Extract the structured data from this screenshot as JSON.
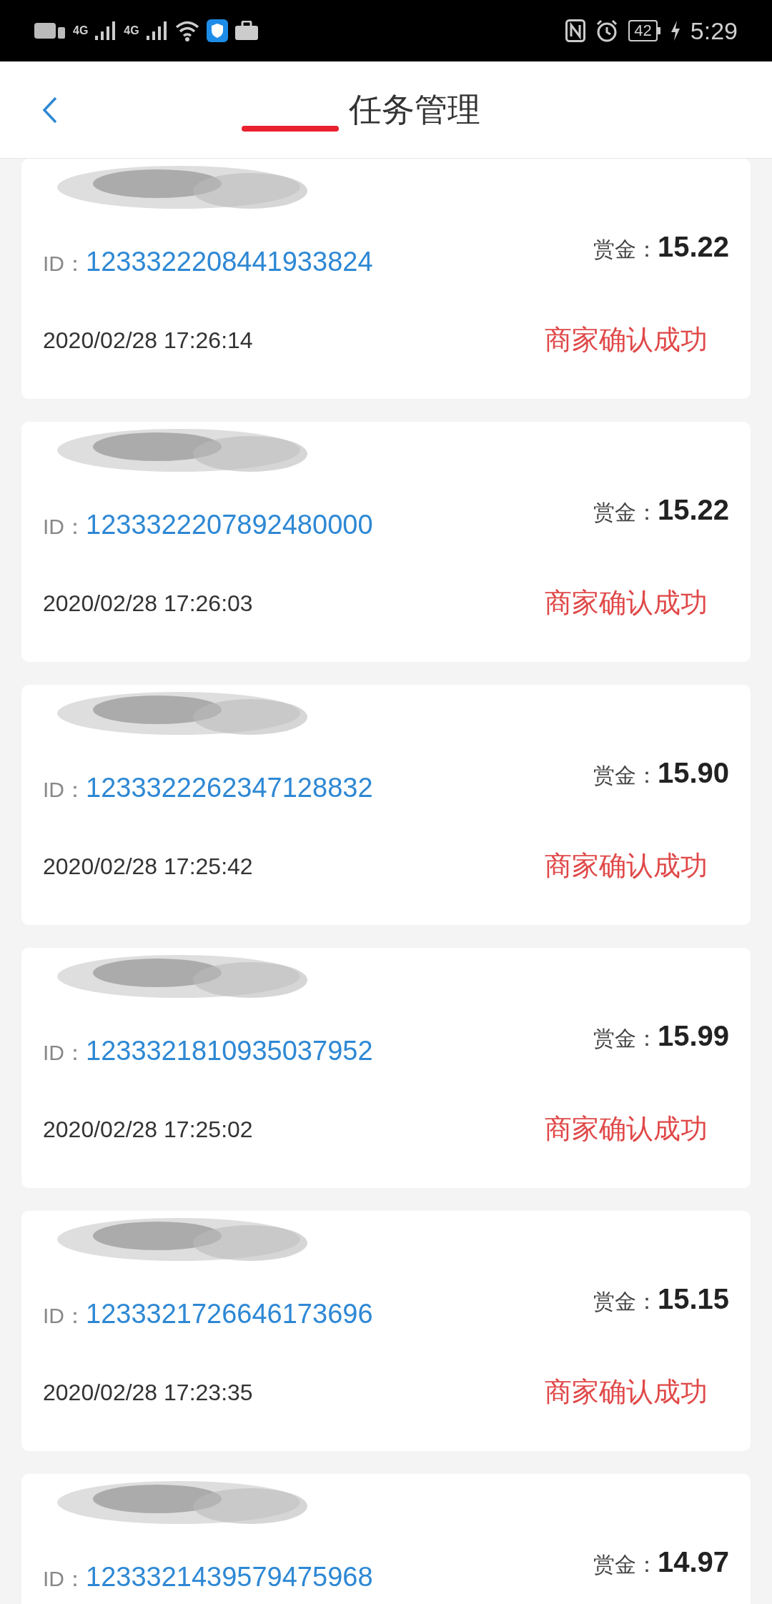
{
  "status_bar": {
    "time": "5:29",
    "battery": "42",
    "network_1": "4G",
    "network_2": "4G"
  },
  "header": {
    "title": "任务管理"
  },
  "tasks": [
    {
      "id_label": "ID：",
      "id": "1233322208441933824",
      "reward_label": "赏金：",
      "reward": "15.22",
      "time": "2020/02/28 17:26:14",
      "status": "商家确认成功"
    },
    {
      "id_label": "ID：",
      "id": "1233322207892480000",
      "reward_label": "赏金：",
      "reward": "15.22",
      "time": "2020/02/28 17:26:03",
      "status": "商家确认成功"
    },
    {
      "id_label": "ID：",
      "id": "1233322262347128832",
      "reward_label": "赏金：",
      "reward": "15.90",
      "time": "2020/02/28 17:25:42",
      "status": "商家确认成功"
    },
    {
      "id_label": "ID：",
      "id": "1233321810935037952",
      "reward_label": "赏金：",
      "reward": "15.99",
      "time": "2020/02/28 17:25:02",
      "status": "商家确认成功"
    },
    {
      "id_label": "ID：",
      "id": "1233321726646173696",
      "reward_label": "赏金：",
      "reward": "15.15",
      "time": "2020/02/28 17:23:35",
      "status": "商家确认成功"
    },
    {
      "id_label": "ID：",
      "id": "1233321439579475968",
      "reward_label": "赏金：",
      "reward": "14.97"
    }
  ]
}
